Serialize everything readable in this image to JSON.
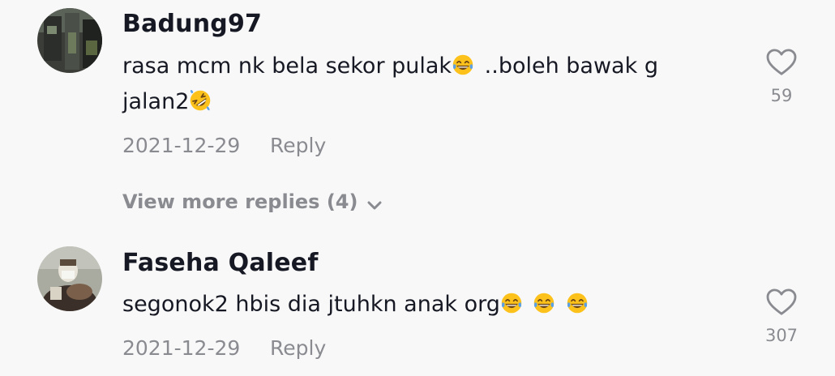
{
  "comments": [
    {
      "author": "Badung97",
      "text_part1": "rasa mcm nk bela sekor pulak",
      "text_part2": " ..boleh bawak g",
      "text_line2": "jalan2",
      "date": "2021-12-29",
      "reply_label": "Reply",
      "likes": "59",
      "emojis": [
        "face-with-tears-of-joy",
        "rolling-on-floor-laughing"
      ]
    },
    {
      "author": "Faseha Qaleef",
      "text": "segonok2 hbis dia jtuhkn anak org",
      "date": "2021-12-29",
      "reply_label": "Reply",
      "likes": "307",
      "emojis": [
        "face-with-tears-of-joy",
        "face-with-tears-of-joy",
        "face-with-tears-of-joy"
      ]
    }
  ],
  "view_more": {
    "label": "View more replies (4)"
  },
  "icons": {
    "like": "heart-outline-icon",
    "expand": "chevron-down-icon"
  },
  "colors": {
    "background": "#f8f8f8",
    "primary_text": "#161823",
    "secondary_text": "#8a8b91",
    "emoji_yellow": "#fcc21b",
    "emoji_tear": "#5aa0e6"
  }
}
